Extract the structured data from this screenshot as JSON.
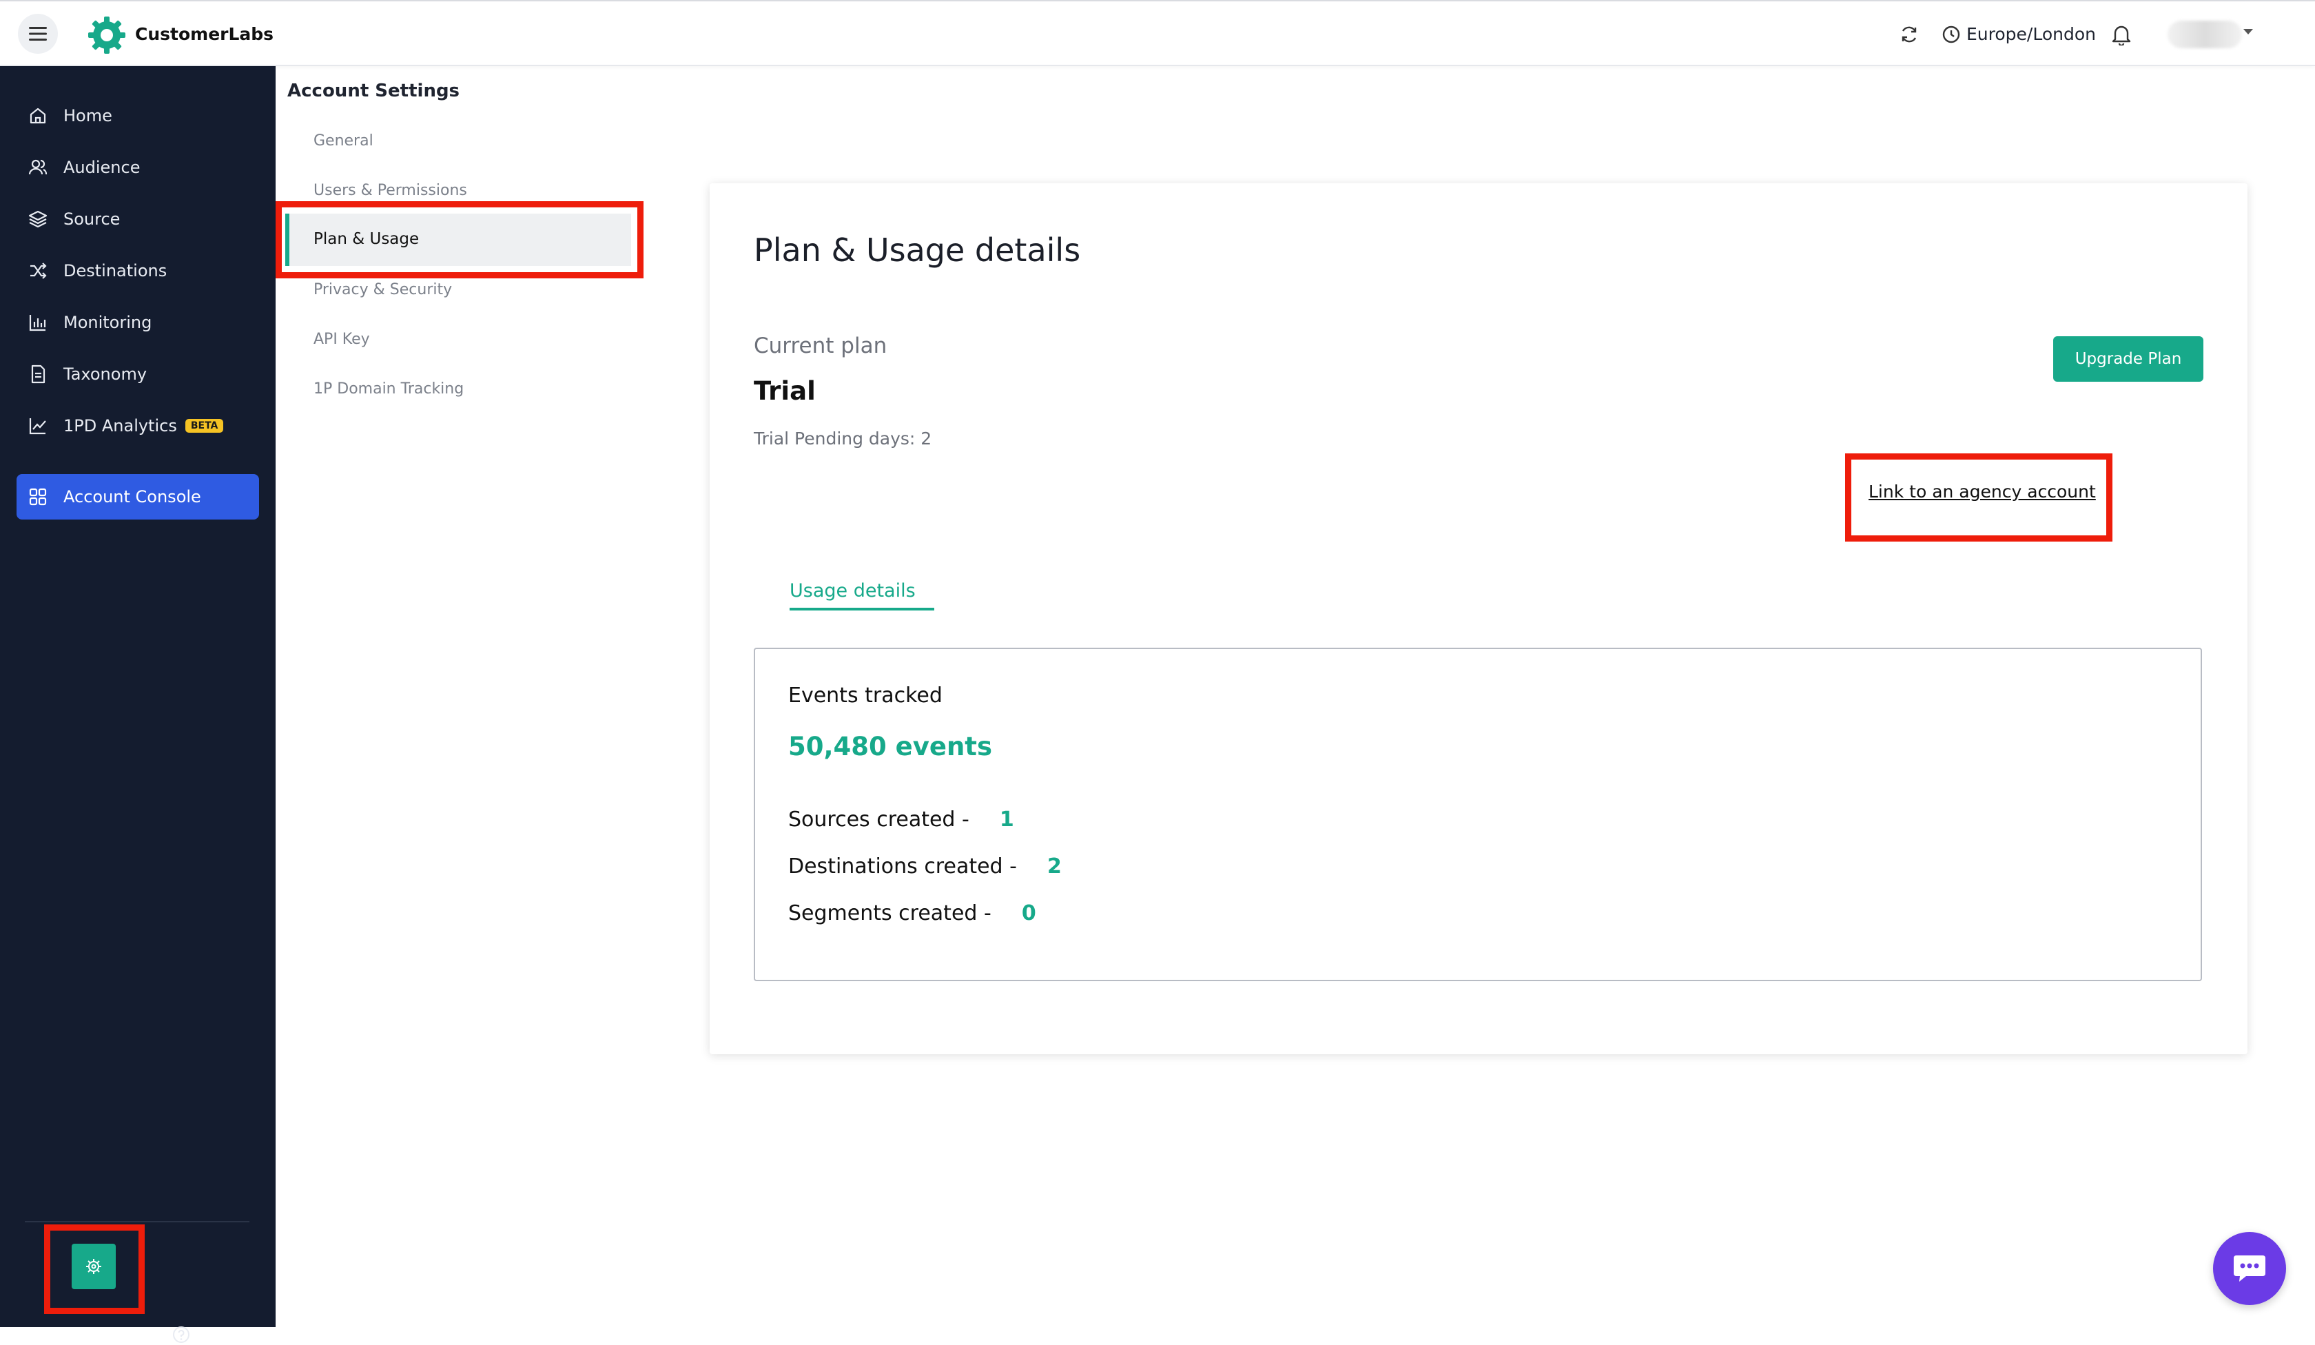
{
  "header": {
    "brand": "CustomerLabs",
    "timezone": "Europe/London"
  },
  "sidebar": {
    "items": [
      {
        "label": "Home",
        "icon": "home-icon"
      },
      {
        "label": "Audience",
        "icon": "users-icon"
      },
      {
        "label": "Source",
        "icon": "layers-icon"
      },
      {
        "label": "Destinations",
        "icon": "shuffle-icon"
      },
      {
        "label": "Monitoring",
        "icon": "bar-chart-icon"
      },
      {
        "label": "Taxonomy",
        "icon": "document-icon"
      },
      {
        "label": "1PD Analytics",
        "icon": "trend-icon",
        "badge": "BETA"
      }
    ],
    "active": {
      "label": "Account Console",
      "icon": "grid-icon"
    }
  },
  "settings": {
    "title": "Account Settings",
    "items": [
      "General",
      "Users & Permissions",
      "Plan & Usage",
      "Privacy & Security",
      "API Key",
      "1P Domain Tracking"
    ],
    "active_index": 2
  },
  "plan": {
    "title": "Plan & Usage details",
    "current_plan_label": "Current plan",
    "plan_name": "Trial",
    "pending": "Trial Pending days: 2",
    "upgrade_button": "Upgrade Plan",
    "agency_link": "Link to an agency account",
    "usage_tab": "Usage details"
  },
  "usage": {
    "events_label": "Events tracked",
    "events_value": "50,480 events",
    "sources_label": "Sources created -",
    "sources_value": "1",
    "destinations_label": "Destinations created -",
    "destinations_value": "2",
    "segments_label": "Segments created -",
    "segments_value": "0"
  },
  "colors": {
    "accent": "#17a98a",
    "sidebar_bg": "#141c2f",
    "active_nav": "#2f5be2",
    "highlight": "#ee1d0b",
    "chat": "#6b3be6",
    "beta_badge": "#f6c324"
  }
}
